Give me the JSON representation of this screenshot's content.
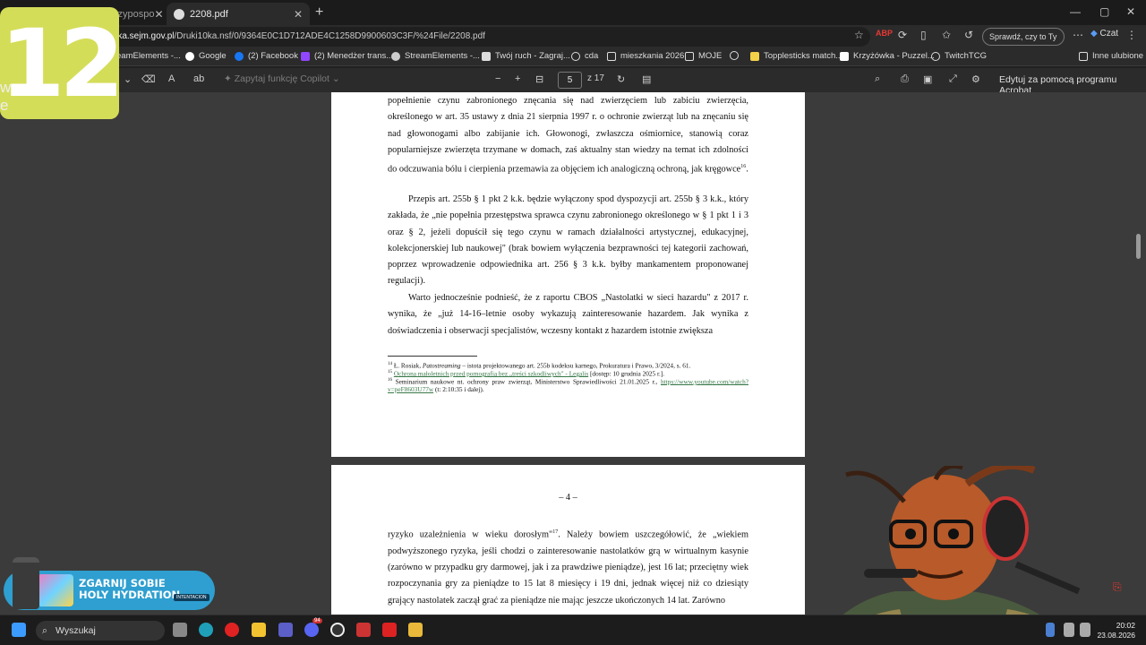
{
  "browser": {
    "tabs": [
      {
        "title": "czypospo"
      },
      {
        "title": "2208.pdf"
      }
    ],
    "url_prefix": "rka.sejm.gov.pl",
    "url_rest": "/Druki10ka.nsf/0/9364E0C1D712ADE4C1258D9900603C3F/%24File/2208.pdf",
    "check_button": "Sprawdź, czy to Ty",
    "chat_button": "Czat",
    "bookmarks": [
      "eamElements -...",
      "Google",
      "(2) Facebook",
      "(2) Menedżer trans...",
      "StreamElements -...",
      "Twój ruch - Zagraj...",
      "cda",
      "mieszkania 2026",
      "MOJE",
      "",
      "Topplesticks match...",
      "Krzyżówka - Puzzel...",
      "TwitchTCG"
    ],
    "other_bookmarks": "Inne ulubione"
  },
  "pdf_toolbar": {
    "copilot_placeholder": "Zapytaj funkcję Copilot",
    "page_current": "5",
    "page_total": "z 17",
    "edit_acrobat": "Edytuj za pomocą programu Acrobat"
  },
  "page1": {
    "para1": "popełnienie czynu zabronionego znęcania się nad zwierzęciem lub zabiciu zwierzęcia, określonego w art. 35 ustawy z dnia 21 sierpnia 1997 r. o ochronie zwierząt lub na znęcaniu się nad głowonogami albo zabijanie ich. Głowonogi, zwłaszcza ośmiornice, stanowią coraz popularniejsze zwierzęta trzymane w domach, zaś aktualny stan wiedzy na temat ich zdolności do odczuwania bólu i cierpienia przemawia za objęciem ich analogiczną ochroną, jak kręgowce",
    "para1_sup": "16",
    "para2": "Przepis art. 255b § 1 pkt 2 k.k. będzie wyłączony spod dyspozycji art. 255b § 3 k.k., który zakłada, że „nie popełnia przestępstwa sprawca czynu zabronionego określonego w § 1 pkt 1 i 3 oraz § 2, jeżeli dopuścił się tego czynu w ramach działalności artystycznej, edukacyjnej, kolekcjonerskiej lub naukowej\" (brak bowiem wyłączenia bezprawności tej kategorii zachowań, poprzez wprowadzenie odpowiednika art. 256 § 3 k.k. byłby mankamentem proponowanej regulacji).",
    "para3": "Warto jednocześnie podnieść, że z raportu CBOS „Nastolatki w sieci hazardu\" z 2017 r. wynika, że „już 14-16–letnie osoby wykazują zainteresowanie hazardem. Jak wynika z doświadczenia i obserwacji specjalistów, wczesny kontakt z hazardem istotnie zwiększa",
    "fn14_num": "14",
    "fn14_a": " Ł. Rosiak, ",
    "fn14_italic": "Patostreaming",
    "fn14_b": " – istota projektowanego art. 255b kodeksu karnego, Prokuratura i Prawo, 3/2024, s. 61.",
    "fn15_num": "15",
    "fn15_link": "Ochrona małoletnich przed pornografią bez „treści szkodliwych\" - Legalis",
    "fn15_b": " [dostęp: 10 grudnia 2025 r.].",
    "fn16_num": "16",
    "fn16_a": "   Seminarium naukowe nt. ochrony praw zwierząt, Ministerstwo Sprawiedliwości 21.01.2025 r., ",
    "fn16_link": "https://www.youtube.com/watch?v=peF8603U77w",
    "fn16_b": " (t: 2:10:35 i dalej)."
  },
  "page2": {
    "page_number": "– 4 –",
    "para1": "ryzyko uzależnienia w wieku dorosłym\"",
    "para1_sup": "17",
    "para1_rest": ". Należy bowiem uszczegółowić, że „wiekiem podwyższonego ryzyka, jeśli chodzi o zainteresowanie nastolatków grą w wirtualnym kasynie (zarówno w przypadku gry darmowej, jak i za prawdziwe pieniądze), jest 16 lat; przeciętny wiek rozpoczynania gry za pieniądze to 15 lat 8 miesięcy i 19 dni, jednak więcej niż co dziesiąty grający nastolatek zaczął grać za pieniądze nie mając jeszcze ukończonych 14 lat. Zarówno"
  },
  "overlay": {
    "badge": "12",
    "side_text": "w\ne",
    "promo_line1": "ZGARNIJ SOBIE",
    "promo_line2": "HOLY HYDRATION",
    "promo_tag": "INTENTACION"
  },
  "taskbar": {
    "search_label": "Wyszukaj",
    "badge_count": "94",
    "time": "20:02",
    "date": "23.08.2026"
  }
}
